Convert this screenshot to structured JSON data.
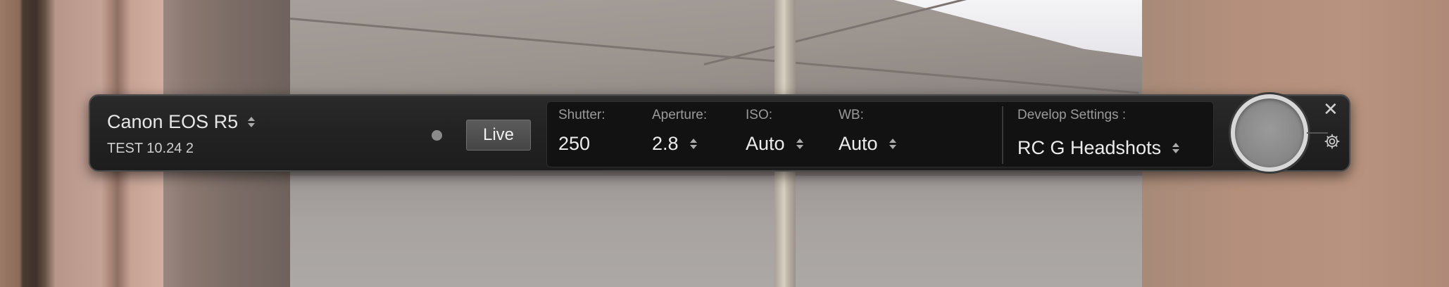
{
  "camera": {
    "name": "Canon EOS R5",
    "session": "TEST 10.24 2"
  },
  "live_button": {
    "label": "Live"
  },
  "settings": {
    "shutter": {
      "label": "Shutter:",
      "value": "250"
    },
    "aperture": {
      "label": "Aperture:",
      "value": "2.8"
    },
    "iso": {
      "label": "ISO:",
      "value": "Auto"
    },
    "wb": {
      "label": "WB:",
      "value": "Auto"
    },
    "develop": {
      "label": "Develop Settings :",
      "value": "RC G Headshots"
    }
  },
  "icons": {
    "updown": "updown-arrows-icon",
    "close": "close-icon",
    "gear": "gear-icon"
  },
  "colors": {
    "bar_bg": "#222222",
    "panel_bg": "#121212",
    "capture_ring": "#d8d8d8"
  }
}
